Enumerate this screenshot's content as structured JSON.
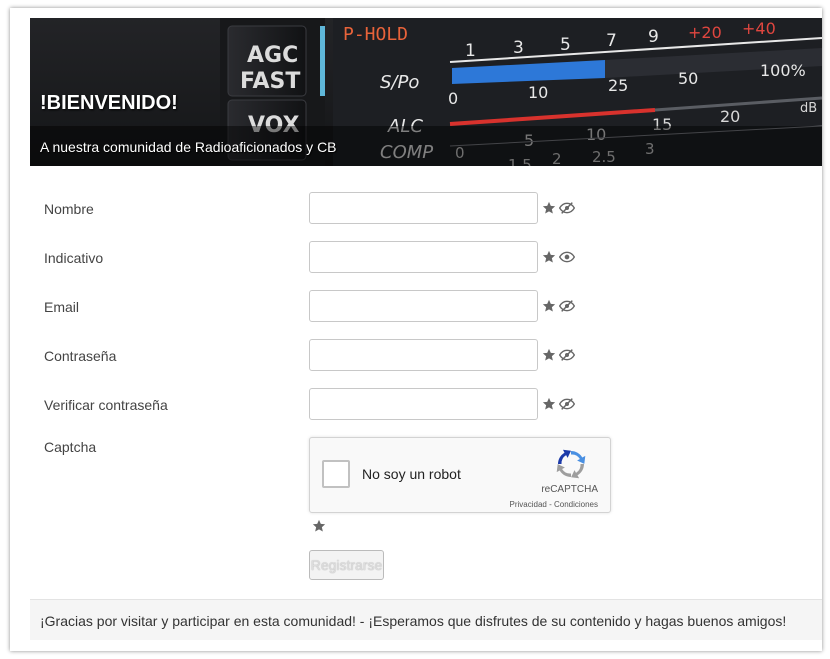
{
  "banner": {
    "title": "!BIENVENIDO!",
    "caption": "A nuestra comunidad de Radioaficionados y CB",
    "photo_labels": {
      "agc": "AGC",
      "fast": "FAST",
      "vox": "VOX",
      "phold": "P-HOLD",
      "spo": "S/Po",
      "alc": "ALC",
      "comp": "COMP",
      "scale_top": [
        "1",
        "3",
        "5",
        "7",
        "9",
        "+20",
        "+40"
      ],
      "scale_mid": [
        "0",
        "10",
        "25",
        "50",
        "100%"
      ],
      "scale_alc": [
        "5",
        "10",
        "15",
        "20",
        "dB"
      ],
      "scale_comp": [
        "0",
        "1.5",
        "2",
        "2.5",
        "3"
      ]
    }
  },
  "form": {
    "fields": [
      {
        "label": "Nombre",
        "value": "",
        "visible_icon": "eye-slash-icon"
      },
      {
        "label": "Indicativo",
        "value": "",
        "visible_icon": "eye-icon"
      },
      {
        "label": "Email",
        "value": "",
        "visible_icon": "eye-slash-icon"
      },
      {
        "label": "Contraseña",
        "value": "",
        "visible_icon": "eye-slash-icon"
      },
      {
        "label": "Verificar contraseña",
        "value": "",
        "visible_icon": "eye-slash-icon"
      }
    ],
    "captcha": {
      "label": "Captcha",
      "checkbox_text": "No soy un robot",
      "brand": "reCAPTCHA",
      "links": "Privacidad - Condiciones"
    },
    "submit_label": "Registrarse"
  },
  "footer": {
    "text": "¡Gracias por visitar y participar en esta comunidad! - ¡Esperamos que disfrutes de su contenido y hagas buenos amigos!"
  },
  "colors": {
    "icon_gray": "#666666",
    "meter_blue": "#2d78d8",
    "meter_red": "#d8322d",
    "meter_orange": "#e8633a"
  }
}
